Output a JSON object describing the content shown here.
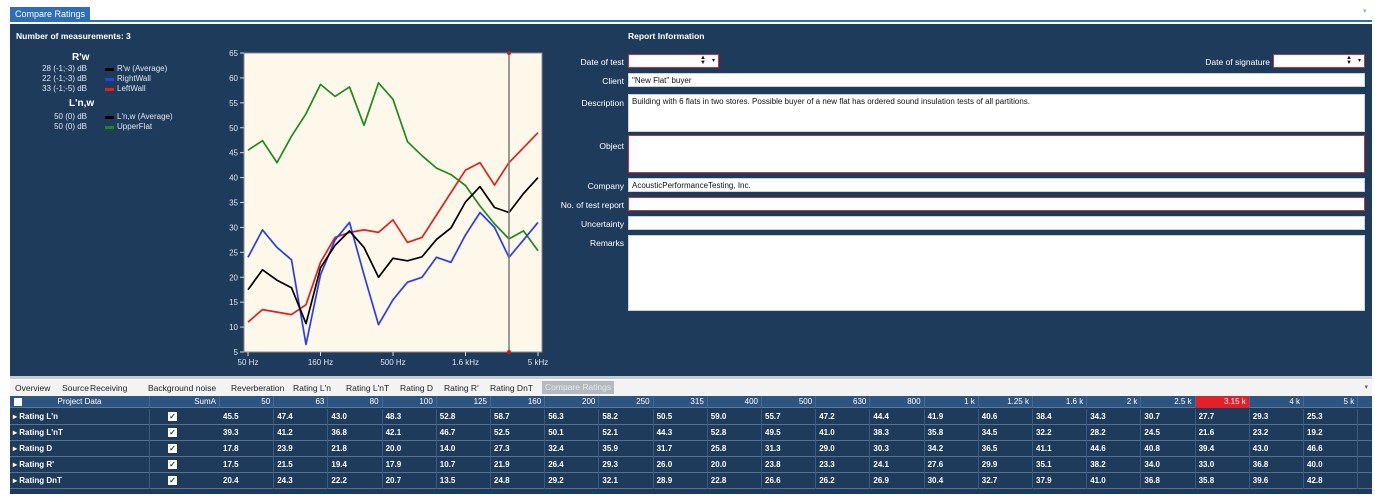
{
  "tab_title": "Compare Ratings",
  "left": {
    "count_label": "Number of measurements: 3",
    "rw_heading": "R'w",
    "rw_items": [
      {
        "value": "28 (-1;-3) dB",
        "name": "R'w (Average)",
        "color": "#000000"
      },
      {
        "value": "22 (-1;-3) dB",
        "name": "RightWall",
        "color": "#2b3cf0"
      },
      {
        "value": "33 (-1;-5) dB",
        "name": "LeftWall",
        "color": "#e02020"
      }
    ],
    "lnw_heading": "L'n,w",
    "lnw_items": [
      {
        "value": "50 (0) dB",
        "name": "L'n,w (Average)",
        "color": "#000000"
      },
      {
        "value": "50 (0) dB",
        "name": "UpperFlat",
        "color": "#1e8a1e"
      }
    ]
  },
  "chart_data": {
    "type": "line",
    "x": [
      "50",
      "63",
      "80",
      "100",
      "125",
      "160",
      "200",
      "250",
      "315",
      "400",
      "500",
      "630",
      "800",
      "1k",
      "1.25k",
      "1.6k",
      "2k",
      "2.5k",
      "3.15k",
      "4k",
      "5k"
    ],
    "x_tick_labels": [
      "50 Hz",
      "160 Hz",
      "500 Hz",
      "1.6 kHz",
      "5 kHz"
    ],
    "y_ticks": [
      5,
      10,
      15,
      20,
      25,
      30,
      35,
      40,
      45,
      50,
      55,
      60,
      65
    ],
    "ylim": [
      5,
      65
    ],
    "grid": false,
    "cursor_at": "3.15k",
    "series": [
      {
        "name": "R'w (Average)",
        "color": "#000000",
        "values": [
          17.5,
          21.5,
          19.4,
          17.9,
          10.7,
          21.9,
          26.4,
          29.3,
          26.0,
          20.0,
          23.8,
          23.3,
          24.1,
          27.6,
          29.9,
          35.1,
          38.2,
          34.0,
          33.0,
          36.8,
          40.0
        ]
      },
      {
        "name": "RightWall",
        "color": "#2b3cf0",
        "values": [
          24.0,
          29.5,
          26.0,
          23.5,
          6.5,
          20.5,
          27.5,
          31.0,
          20.5,
          10.5,
          15.5,
          19.0,
          20.0,
          24.0,
          23.0,
          28.5,
          33.0,
          30.0,
          24.0,
          27.5,
          31.0
        ]
      },
      {
        "name": "LeftWall",
        "color": "#e02020",
        "values": [
          11.0,
          13.5,
          13.0,
          12.5,
          14.5,
          23.0,
          28.0,
          29.0,
          29.5,
          29.0,
          31.5,
          27.0,
          28.0,
          32.5,
          37.0,
          41.5,
          43.0,
          38.5,
          43.0,
          46.0,
          49.0
        ]
      },
      {
        "name": "UpperFlat",
        "color": "#1e8a1e",
        "values": [
          45.5,
          47.4,
          43.0,
          48.3,
          52.8,
          58.7,
          56.3,
          58.2,
          50.5,
          59.0,
          55.7,
          47.2,
          44.4,
          41.9,
          40.6,
          38.4,
          34.3,
          30.7,
          27.7,
          29.3,
          25.3
        ]
      }
    ]
  },
  "report": {
    "heading": "Report Information",
    "date_of_test_label": "Date of test",
    "date_of_signature_label": "Date of signature",
    "client_label": "Client",
    "client_value": "\"New Flat\" buyer",
    "description_label": "Description",
    "description_value": "Building with 6 flats in two stores. Possible buyer of a new flat has ordered sound insulation tests of all partitions.",
    "object_label": "Object",
    "company_label": "Company",
    "company_value": "AcousticPerformanceTesting, Inc.",
    "report_no_label": "No. of test report",
    "uncertainty_label": "Uncertainty",
    "remarks_label": "Remarks"
  },
  "bottom_tabs": [
    "Overview",
    "Source",
    "Receiving",
    "Background noise",
    "Reverberation",
    "Rating L'n",
    "Rating L'nT",
    "Rating D",
    "Rating R'",
    "Rating DnT",
    "Compare Ratings"
  ],
  "active_tab": "Compare Ratings",
  "table": {
    "project_header": "Project Data",
    "columns": [
      "SumA",
      "50",
      "63",
      "80",
      "100",
      "125",
      "160",
      "200",
      "250",
      "315",
      "400",
      "500",
      "630",
      "800",
      "1 k",
      "1.25 k",
      "1.6 k",
      "2 k",
      "2.5 k",
      "3.15 k",
      "4 k",
      "5 k"
    ],
    "highlight_column": "3.15 k",
    "highlight_color": "#e0202a",
    "rows": [
      {
        "name": "Rating L'n",
        "values": [
          "45.5",
          "47.4",
          "43.0",
          "48.3",
          "52.8",
          "58.7",
          "56.3",
          "58.2",
          "50.5",
          "59.0",
          "55.7",
          "47.2",
          "44.4",
          "41.9",
          "40.6",
          "38.4",
          "34.3",
          "30.7",
          "27.7",
          "29.3",
          "25.3"
        ]
      },
      {
        "name": "Rating L'nT",
        "values": [
          "39.3",
          "41.2",
          "36.8",
          "42.1",
          "46.7",
          "52.5",
          "50.1",
          "52.1",
          "44.3",
          "52.8",
          "49.5",
          "41.0",
          "38.3",
          "35.8",
          "34.5",
          "32.2",
          "28.2",
          "24.5",
          "21.6",
          "23.2",
          "19.2"
        ]
      },
      {
        "name": "Rating D",
        "values": [
          "17.8",
          "23.9",
          "21.8",
          "20.0",
          "14.0",
          "27.3",
          "32.4",
          "35.9",
          "31.7",
          "25.8",
          "31.3",
          "29.0",
          "30.3",
          "34.2",
          "36.5",
          "41.1",
          "44.6",
          "40.8",
          "39.4",
          "43.0",
          "46.6"
        ]
      },
      {
        "name": "Rating R'",
        "values": [
          "17.5",
          "21.5",
          "19.4",
          "17.9",
          "10.7",
          "21.9",
          "26.4",
          "29.3",
          "26.0",
          "20.0",
          "23.8",
          "23.3",
          "24.1",
          "27.6",
          "29.9",
          "35.1",
          "38.2",
          "34.0",
          "33.0",
          "36.8",
          "40.0"
        ]
      },
      {
        "name": "Rating DnT",
        "values": [
          "20.4",
          "24.3",
          "22.2",
          "20.7",
          "13.5",
          "24.8",
          "29.2",
          "32.1",
          "28.9",
          "22.8",
          "26.6",
          "26.2",
          "26.9",
          "30.4",
          "32.7",
          "37.9",
          "41.0",
          "36.8",
          "35.8",
          "39.6",
          "42.8"
        ]
      }
    ]
  }
}
